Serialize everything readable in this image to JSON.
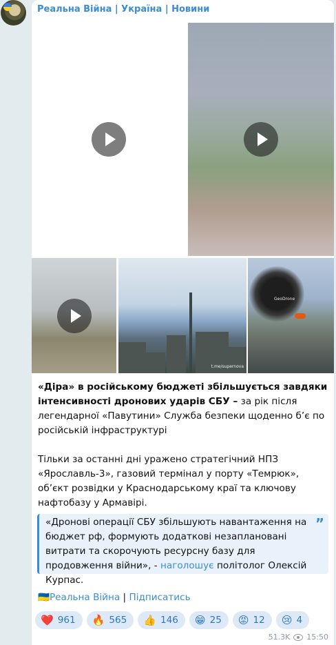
{
  "channel": {
    "name": "Реальна Війна | Україна | Новини"
  },
  "media": {
    "watermark_1": "t.me/supernova",
    "watermark_2": "GeoDrone"
  },
  "post": {
    "headline_bold": "«Діра» в російському бюджеті збільшується завдяки інтенсивності дронових ударів СБУ –",
    "headline_rest": " за рік після легендарної «Павутини» Служба безпеки щоденно б’є по російській інфраструктурі",
    "paragraph2": "Тільки за останні дні уражено стратегічний НПЗ «Ярославль-3», газовий термінал у порту «Темрюк», об’єкт розвідки у Краснодарському краї та ключову нафтобазу у Армавірі.",
    "quote_text": "«Дронові операції СБУ збільшують навантаження на бюджет рф, формують додаткові незаплановані витрати та скорочують ресурсну базу для продовження війни», - ",
    "quote_link": "наголошує",
    "quote_tail": " політолог Олексій Курпас.",
    "quote_mark": "”"
  },
  "footer": {
    "flag": "🇺🇦",
    "channel_link": "Реальна Війна",
    "separator": " | ",
    "subscribe_link": "Підписатись"
  },
  "reactions": [
    {
      "emoji": "❤️",
      "count": "961"
    },
    {
      "emoji": "🔥",
      "count": "565"
    },
    {
      "emoji": "👍",
      "count": "146"
    },
    {
      "emoji": "😁",
      "count": "25"
    },
    {
      "emoji": "😡",
      "count": "12"
    },
    {
      "emoji": "😢",
      "count": "4"
    }
  ],
  "meta": {
    "views": "51.3K",
    "time": "15:50"
  },
  "colors": {
    "accent": "#3a8dd0",
    "background": "#e4ebef",
    "reaction_bg": "#dde9f6"
  }
}
